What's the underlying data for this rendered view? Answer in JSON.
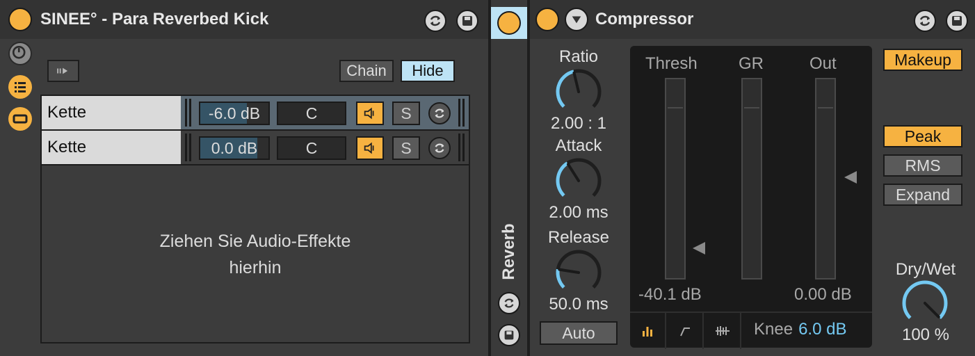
{
  "rack": {
    "title": "SINEE° - Para Reverbed Kick",
    "chain_button": "Chain",
    "hide_button": "Hide",
    "chains": [
      {
        "name": "Kette",
        "volume": "-6.0 dB",
        "volume_fill": 0.68,
        "pan": "C",
        "solo": "S",
        "selected": true
      },
      {
        "name": "Kette",
        "volume": "0.0 dB",
        "volume_fill": 0.84,
        "pan": "C",
        "solo": "S",
        "selected": false
      }
    ],
    "drop_hint_line1": "Ziehen Sie Audio-Effekte",
    "drop_hint_line2": "hierhin"
  },
  "reverb": {
    "label": "Reverb"
  },
  "compressor": {
    "title": "Compressor",
    "ratio": {
      "label": "Ratio",
      "value": "2.00 : 1",
      "knob_level": 0.45
    },
    "attack": {
      "label": "Attack",
      "value": "2.00 ms",
      "knob_level": 0.38
    },
    "release": {
      "label": "Release",
      "value": "50.0 ms",
      "knob_level": 0.2
    },
    "auto_button": "Auto",
    "meters": {
      "thresh_label": "Thresh",
      "gr_label": "GR",
      "out_label": "Out",
      "thresh_value": "-40.1 dB",
      "out_value": "0.00 dB"
    },
    "knee": {
      "label": "Knee",
      "value": "6.0 dB"
    },
    "makeup_button": "Makeup",
    "modes": [
      "Peak",
      "RMS",
      "Expand"
    ],
    "active_mode": "Peak",
    "drywet": {
      "label": "Dry/Wet",
      "value": "100 %",
      "knob_level": 1.0
    }
  },
  "colors": {
    "accent_orange": "#f6b241",
    "accent_blue": "#74c9f2",
    "selected_row": "#5a6873",
    "panel_bg": "#3c3c3c"
  }
}
